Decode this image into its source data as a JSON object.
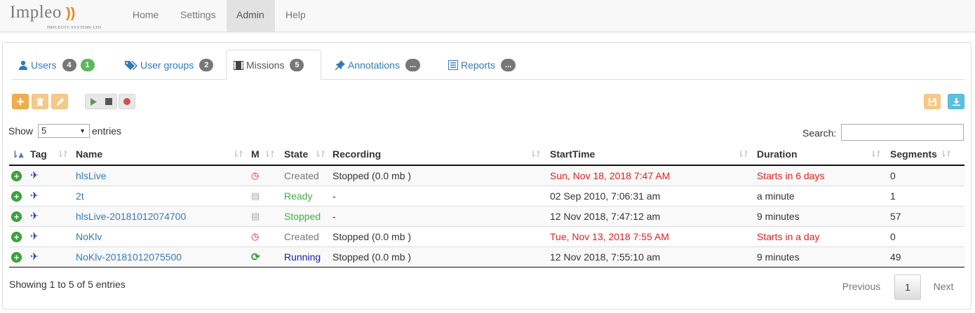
{
  "brand": {
    "name": "Impleo",
    "mark": "))",
    "subtitle": "IMPLEOTV SYSTEMS LTD"
  },
  "nav": {
    "items": [
      {
        "label": "Home"
      },
      {
        "label": "Settings"
      },
      {
        "label": "Admin"
      },
      {
        "label": "Help"
      }
    ],
    "active": "Admin"
  },
  "tabs": [
    {
      "label": "Users",
      "icon": "user-icon",
      "badges": [
        "4",
        "1"
      ]
    },
    {
      "label": "User groups",
      "icon": "tags-icon",
      "badges": [
        "2"
      ]
    },
    {
      "label": "Missions",
      "icon": "film-icon",
      "badges": [
        "5"
      ]
    },
    {
      "label": "Annotations",
      "icon": "pushpin-icon",
      "badges": [
        "..."
      ]
    },
    {
      "label": "Reports",
      "icon": "list-alt-icon",
      "badges": [
        "..."
      ]
    }
  ],
  "toolbar": {
    "add_icon": "plus-icon",
    "delete_icon": "trash-icon",
    "edit_icon": "pencil-icon",
    "play_icon": "play-icon",
    "stop_icon": "stop-icon",
    "record_icon": "record-icon",
    "save_icon": "floppy-icon",
    "download_icon": "download-icon"
  },
  "length": {
    "show_label": "Show",
    "value": "5",
    "entries_label": "entries"
  },
  "search": {
    "label": "Search:",
    "value": ""
  },
  "table": {
    "columns": [
      "Tag",
      "Name",
      "M",
      "State",
      "Recording",
      "StartTime",
      "Duration",
      "Segments"
    ],
    "rows": [
      {
        "name": "hlsLive",
        "m_icon": "clock-icon",
        "state": "Created",
        "recording": "Stopped (0.0 mb )",
        "start": "Sun, Nov 18, 2018 7:47 AM",
        "duration": "Starts in 6 days",
        "segments": "0"
      },
      {
        "name": "2t",
        "m_icon": "document-icon",
        "state": "Ready",
        "recording": "-",
        "start": "02 Sep 2010, 7:06:31 am",
        "duration": "a minute",
        "segments": "1"
      },
      {
        "name": "hlsLive-20181012074700",
        "m_icon": "document-icon",
        "state": "Stopped",
        "recording": "-",
        "start": "12 Nov 2018, 7:47:12 am",
        "duration": "9 minutes",
        "segments": "57"
      },
      {
        "name": "NoKlv",
        "m_icon": "clock-icon",
        "state": "Created",
        "recording": "Stopped (0.0 mb )",
        "start": "Tue, Nov 13, 2018 7:55 AM",
        "duration": "Starts in a day",
        "segments": "0"
      },
      {
        "name": "NoKlv-20181012075500",
        "m_icon": "refresh-icon",
        "state": "Running",
        "recording": "Stopped (0.0 mb )",
        "start": "12 Nov 2018, 7:55:10 am",
        "duration": "9 minutes",
        "segments": "49"
      }
    ]
  },
  "footer": {
    "info": "Showing 1 to 5 of 5 entries",
    "previous": "Previous",
    "page": "1",
    "next": "Next"
  }
}
